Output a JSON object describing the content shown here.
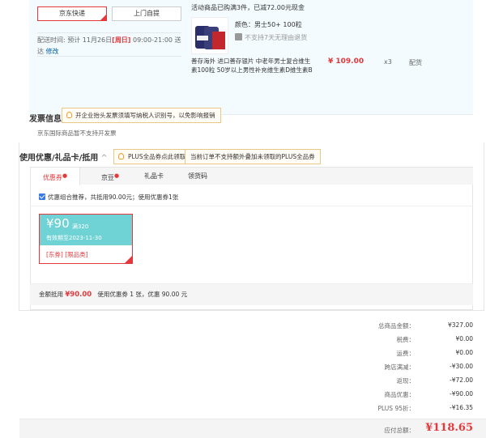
{
  "shipping": {
    "jd_express": "京东快递",
    "pickup": "上门自提",
    "delivery_prefix": "配送时间:",
    "delivery_text": "预计 11月26日",
    "delivery_day": "[周日]",
    "delivery_time": "09:00-21:00 送达",
    "modify": "修改"
  },
  "product": {
    "promo": "活动商品已购满3件，已减72.00元现金",
    "color": "颜色：男士50+ 100粒",
    "no_return": "不支持7天无理由退货",
    "name": "善存海外 进口善存银片 中老年男士复合维生素100粒 50岁以上男性补充维生素D维生素B",
    "price": "¥ 109.00",
    "qty": "x3",
    "stock": "配货"
  },
  "invoice": {
    "title": "发票信息",
    "tip": "开企业抬头发票须填写纳税人识别号，以免影响报销",
    "note": "京东国际商品暂不支持开发票"
  },
  "coupon": {
    "title": "使用优惠/礼品卡/抵用",
    "caret": "^",
    "plus_tip": "PLUS全品券点此领取",
    "plus_note": "当前订单不支持额外叠加未领取的PLUS全品券",
    "tabs": [
      "优惠券",
      "京豆",
      "礼品卡",
      "领货码"
    ],
    "recommend": "优惠组合推荐，共抵用90.00元；使用优惠券1张",
    "card": {
      "amount": "¥90",
      "condition": "满320",
      "valid": "有效期至2023-11-30",
      "tags": "[东券] [限品类]"
    },
    "deduct_prefix": "金额抵用",
    "deduct_amount": "¥90.00",
    "deduct_suffix": "使用优惠券 1 张，优惠 90.00 元"
  },
  "summary": {
    "rows": [
      {
        "label": "总商品金额：",
        "value": "¥327.00"
      },
      {
        "label": "税费：",
        "value": "¥0.00"
      },
      {
        "label": "运费：",
        "value": "¥0.00"
      },
      {
        "label": "跨店满减：",
        "value": "-¥30.00"
      },
      {
        "label": "返现：",
        "value": "-¥72.00"
      },
      {
        "label": "商品优惠：",
        "value": "-¥90.00"
      },
      {
        "label": "PLUS 95折：",
        "value": "-¥16.35"
      }
    ],
    "total_label": "应付总额：",
    "total_value": "¥118.65"
  }
}
